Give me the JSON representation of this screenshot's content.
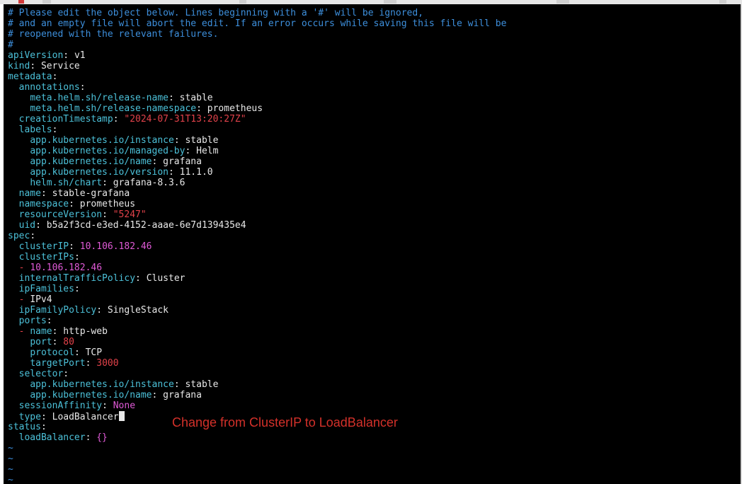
{
  "editor": {
    "header_comments": [
      "# Please edit the object below. Lines beginning with a '#' will be ignored,",
      "# and an empty file will abort the edit. If an error occurs while saving this file will be",
      "# reopened with the relevant failures.",
      "#"
    ],
    "lines": [
      {
        "indent": "",
        "key": "apiVersion",
        "value": "v1",
        "vtype": "val"
      },
      {
        "indent": "",
        "key": "kind",
        "value": "Service",
        "vtype": "val"
      },
      {
        "indent": "",
        "key": "metadata",
        "value": "",
        "vtype": "val"
      },
      {
        "indent": "  ",
        "key": "annotations",
        "value": "",
        "vtype": "val"
      },
      {
        "indent": "    ",
        "key": "meta.helm.sh/release-name",
        "value": "stable",
        "vtype": "val"
      },
      {
        "indent": "    ",
        "key": "meta.helm.sh/release-namespace",
        "value": "prometheus",
        "vtype": "val"
      },
      {
        "indent": "  ",
        "key": "creationTimestamp",
        "value": "\"2024-07-31T13:20:27Z\"",
        "vtype": "str"
      },
      {
        "indent": "  ",
        "key": "labels",
        "value": "",
        "vtype": "val"
      },
      {
        "indent": "    ",
        "key": "app.kubernetes.io/instance",
        "value": "stable",
        "vtype": "val"
      },
      {
        "indent": "    ",
        "key": "app.kubernetes.io/managed-by",
        "value": "Helm",
        "vtype": "val"
      },
      {
        "indent": "    ",
        "key": "app.kubernetes.io/name",
        "value": "grafana",
        "vtype": "val"
      },
      {
        "indent": "    ",
        "key": "app.kubernetes.io/version",
        "value": "11.1.0",
        "vtype": "val"
      },
      {
        "indent": "    ",
        "key": "helm.sh/chart",
        "value": "grafana-8.3.6",
        "vtype": "val"
      },
      {
        "indent": "  ",
        "key": "name",
        "value": "stable-grafana",
        "vtype": "val"
      },
      {
        "indent": "  ",
        "key": "namespace",
        "value": "prometheus",
        "vtype": "val"
      },
      {
        "indent": "  ",
        "key": "resourceVersion",
        "value": "\"5247\"",
        "vtype": "str"
      },
      {
        "indent": "  ",
        "key": "uid",
        "value": "b5a2f3cd-e3ed-4152-aaae-6e7d139435e4",
        "vtype": "val"
      },
      {
        "indent": "",
        "key": "spec",
        "value": "",
        "vtype": "val"
      },
      {
        "indent": "  ",
        "key": "clusterIP",
        "value": "10.106.182.46",
        "vtype": "num"
      },
      {
        "indent": "  ",
        "key": "clusterIPs",
        "value": "",
        "vtype": "val"
      },
      {
        "indent": "  ",
        "dash": true,
        "key": "",
        "value": "10.106.182.46",
        "vtype": "num"
      },
      {
        "indent": "  ",
        "key": "internalTrafficPolicy",
        "value": "Cluster",
        "vtype": "val"
      },
      {
        "indent": "  ",
        "key": "ipFamilies",
        "value": "",
        "vtype": "val"
      },
      {
        "indent": "  ",
        "dash": true,
        "key": "",
        "value": "IPv4",
        "vtype": "val"
      },
      {
        "indent": "  ",
        "key": "ipFamilyPolicy",
        "value": "SingleStack",
        "vtype": "val"
      },
      {
        "indent": "  ",
        "key": "ports",
        "value": "",
        "vtype": "val"
      },
      {
        "indent": "  ",
        "dash": true,
        "key": "name",
        "value": "http-web",
        "vtype": "val"
      },
      {
        "indent": "    ",
        "key": "port",
        "value": "80",
        "vtype": "str"
      },
      {
        "indent": "    ",
        "key": "protocol",
        "value": "TCP",
        "vtype": "val"
      },
      {
        "indent": "    ",
        "key": "targetPort",
        "value": "3000",
        "vtype": "str"
      },
      {
        "indent": "  ",
        "key": "selector",
        "value": "",
        "vtype": "val"
      },
      {
        "indent": "    ",
        "key": "app.kubernetes.io/instance",
        "value": "stable",
        "vtype": "val"
      },
      {
        "indent": "    ",
        "key": "app.kubernetes.io/name",
        "value": "grafana",
        "vtype": "val"
      },
      {
        "indent": "  ",
        "key": "sessionAffinity",
        "value": "None",
        "vtype": "num"
      },
      {
        "indent": "  ",
        "key": "type",
        "value": "LoadBalancer",
        "vtype": "val",
        "cursor": true
      },
      {
        "indent": "",
        "key": "status",
        "value": "",
        "vtype": "val"
      },
      {
        "indent": "  ",
        "key": "loadBalancer",
        "value": "{}",
        "vtype": "num"
      }
    ],
    "tilde_lines": [
      "~",
      "~",
      "~",
      "~"
    ]
  },
  "annotation": {
    "text": "Change from ClusterIP to LoadBalancer"
  },
  "colors": {
    "comment": "#3d8fdc",
    "key": "#4cc1d9",
    "string": "#e2424a",
    "number": "#e05ad7",
    "annotation": "#d4312a"
  }
}
